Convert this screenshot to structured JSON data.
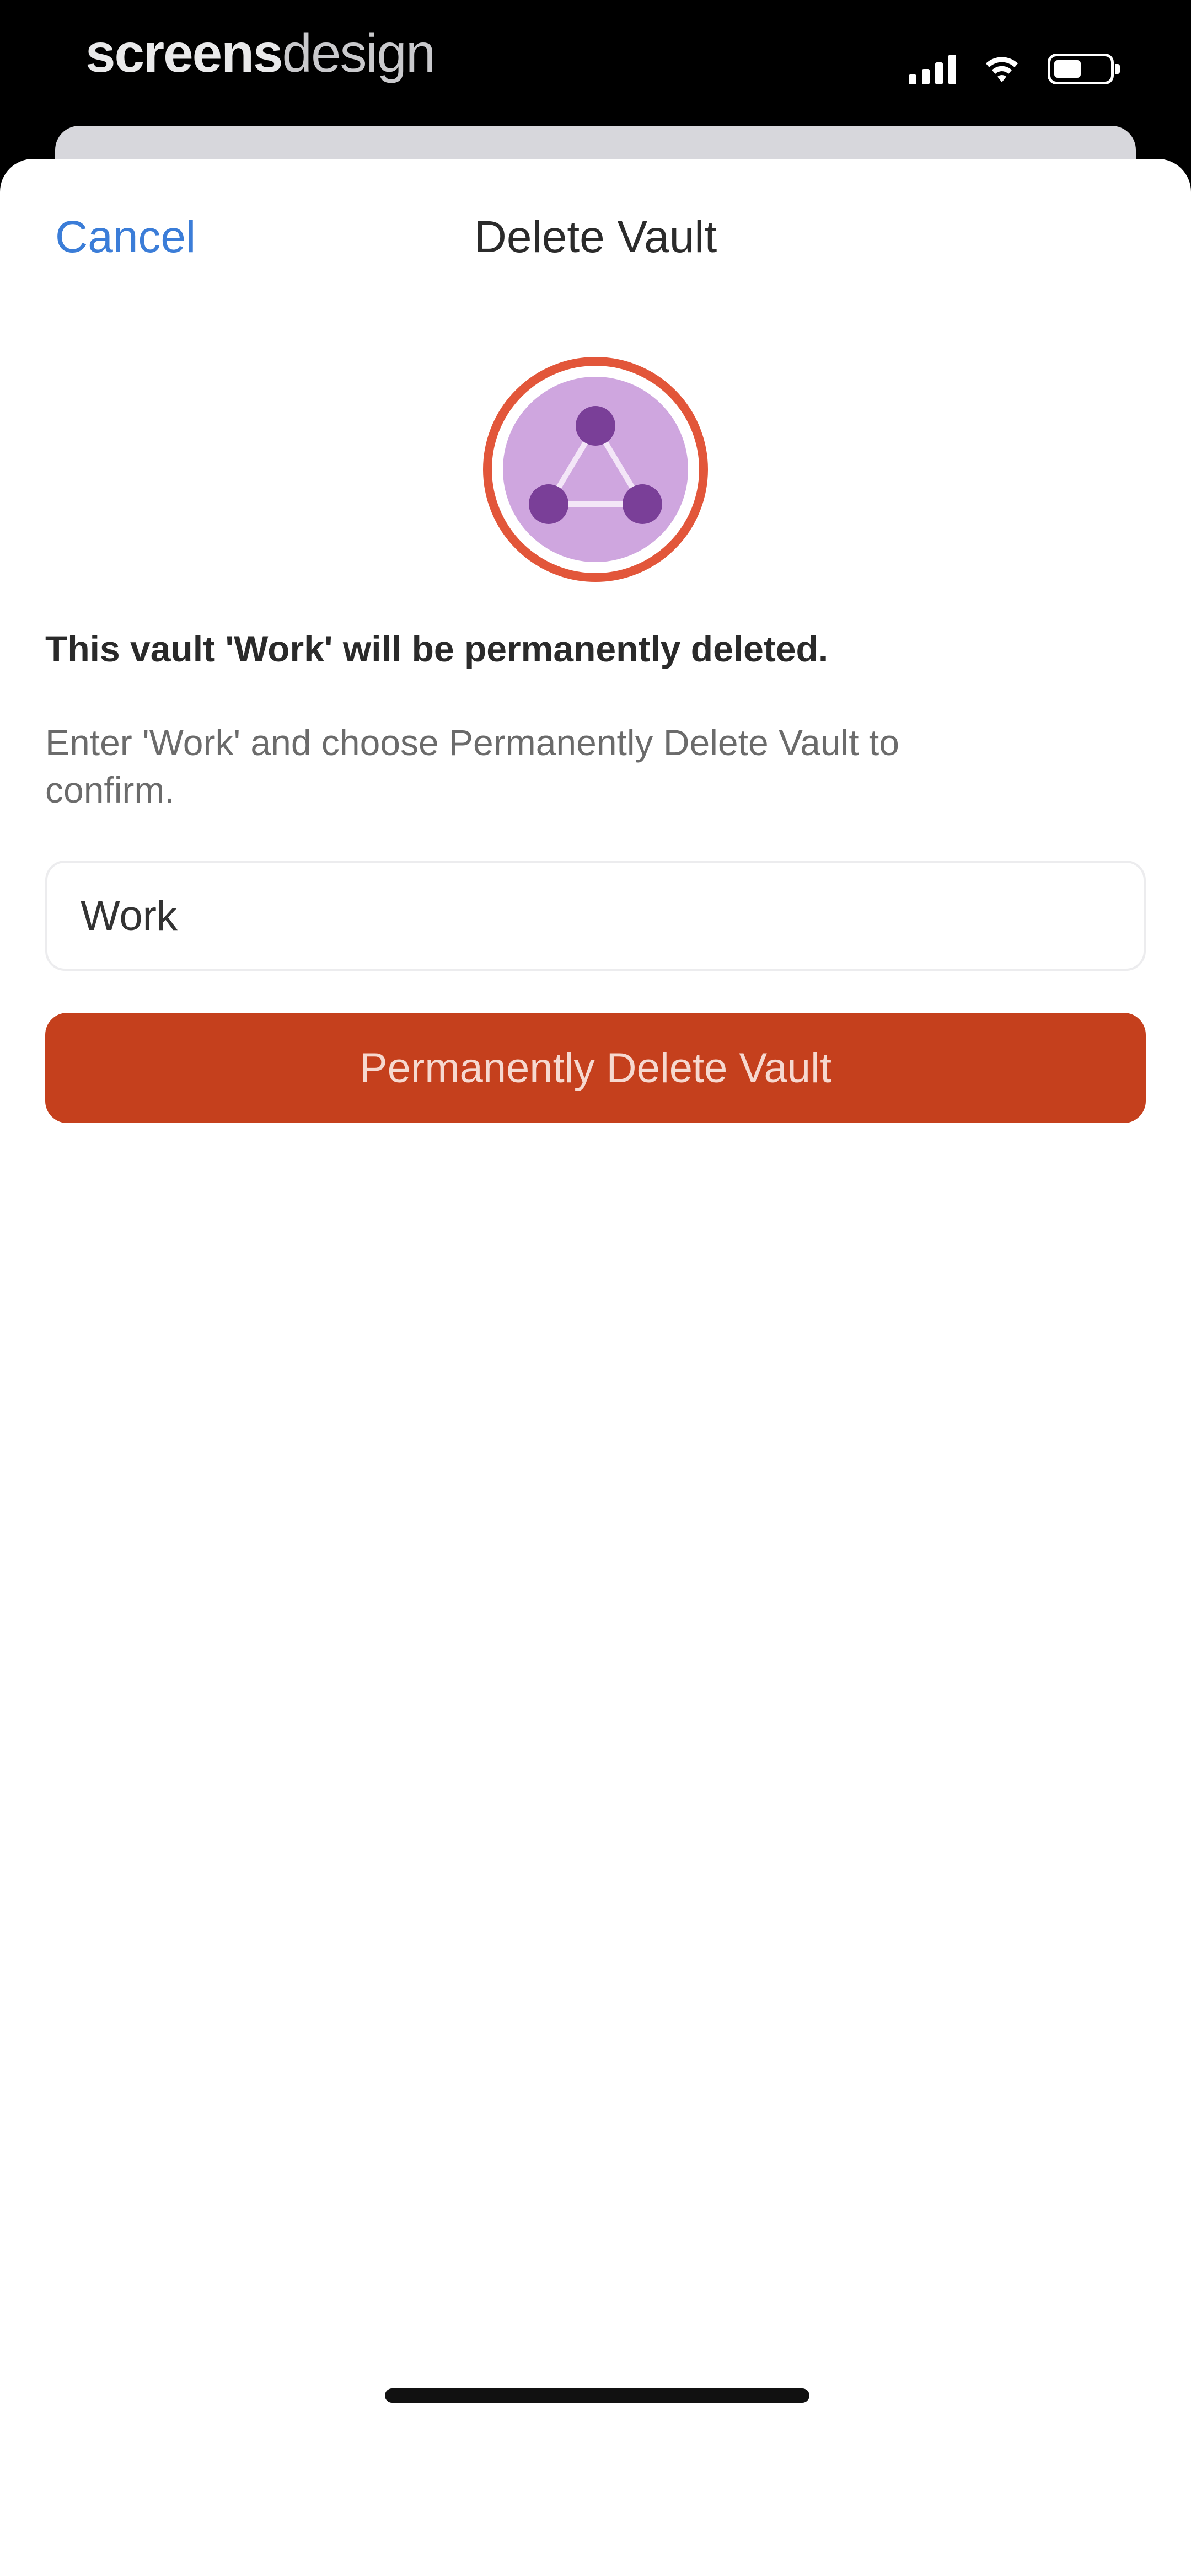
{
  "status_bar": {
    "brand_part1": "screens",
    "brand_part2": "design",
    "signal_icon": "cellular-signal-icon",
    "wifi_icon": "wifi-icon",
    "battery_icon": "battery-icon",
    "battery_level": 0.5
  },
  "nav": {
    "cancel_label": "Cancel",
    "title": "Delete Vault"
  },
  "vault_icon": {
    "icon": "vault-network-icon",
    "ring_color": "#e2563a",
    "fill_color": "#cfa6df",
    "node_color": "#7a3f98"
  },
  "message": {
    "warning": "This vault 'Work' will be permanently deleted.",
    "instructions": "Enter 'Work' and choose Permanently Delete Vault to confirm."
  },
  "confirm_input": {
    "value": "Work",
    "placeholder": ""
  },
  "delete_button": {
    "label": "Permanently Delete Vault",
    "color": "#c5401d"
  },
  "colors": {
    "accent": "#3b7dd8",
    "danger": "#c5401d"
  }
}
